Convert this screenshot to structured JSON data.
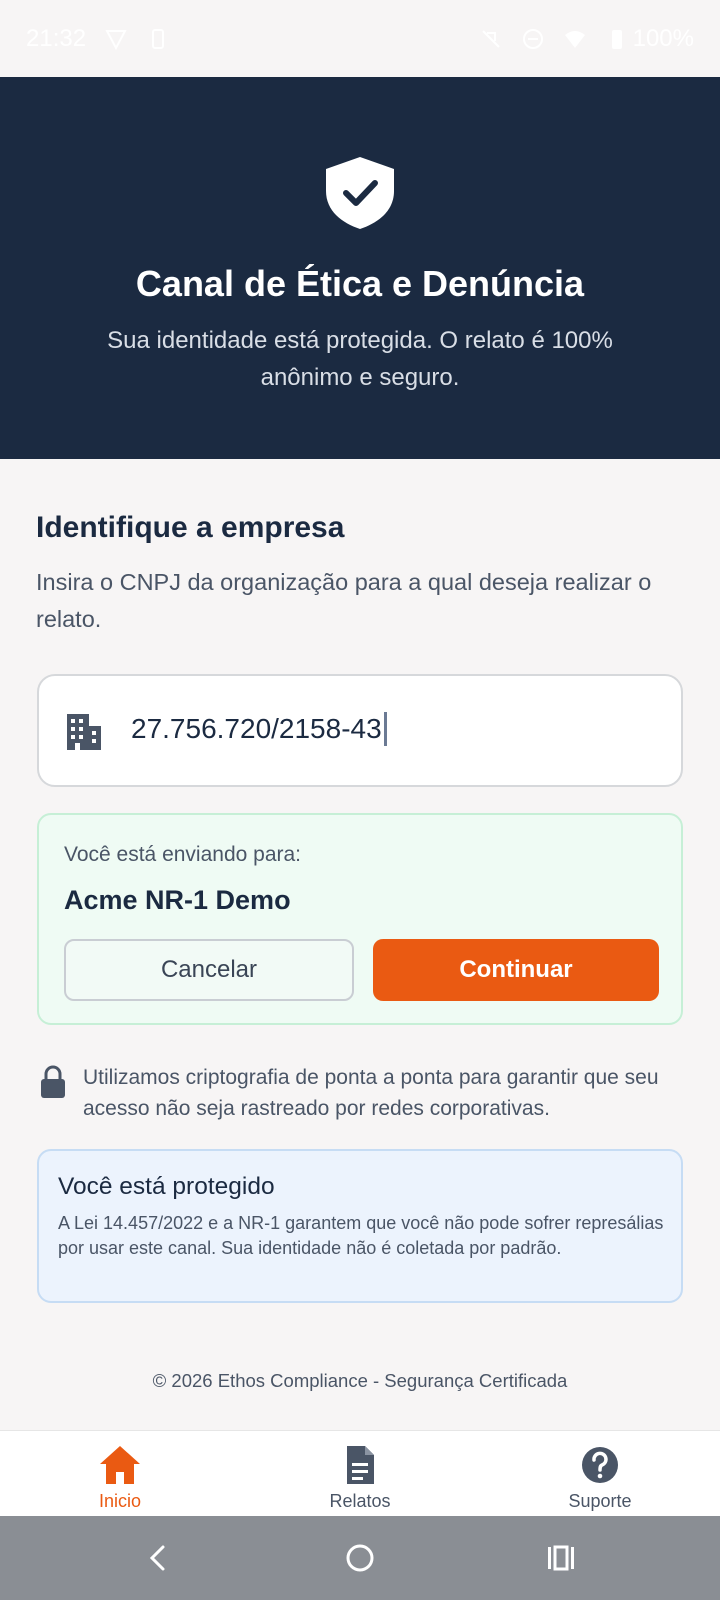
{
  "status_bar": {
    "time": "21:32",
    "battery": "100%"
  },
  "hero": {
    "title": "Canal de Ética e Denúncia",
    "subtitle": "Sua identidade está protegida. O relato é 100% anônimo e seguro."
  },
  "company": {
    "title": "Identifique a empresa",
    "description": "Insira o CNPJ da organização para a qual deseja realizar o relato.",
    "cnpj_value": "27.756.720/2158-43"
  },
  "destination": {
    "label": "Você está enviando para:",
    "name": "Acme NR-1 Demo",
    "cancel_label": "Cancelar",
    "continue_label": "Continuar"
  },
  "security_note": "Utilizamos criptografia de ponta a ponta para garantir que seu acesso não seja rastreado por redes corporativas.",
  "protection": {
    "title": "Você está protegido",
    "body": "A Lei 14.457/2022 e a NR-1 garantem que você não pode sofrer represálias por usar este canal. Sua identidade não é coletada por padrão."
  },
  "footer": "© 2026 Ethos Compliance - Segurança Certificada",
  "tabs": [
    {
      "label": "Inicio",
      "icon": "home-icon",
      "active": true
    },
    {
      "label": "Relatos",
      "icon": "document-icon",
      "active": false
    },
    {
      "label": "Suporte",
      "icon": "help-icon",
      "active": false
    }
  ],
  "colors": {
    "primary": "#1b2a41",
    "accent": "#ea5a12",
    "success_bg": "#effbf4",
    "info_bg": "#ecf3fd"
  }
}
